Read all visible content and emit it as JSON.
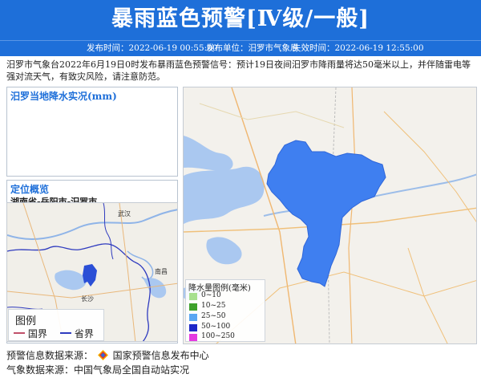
{
  "header": {
    "title": "暴雨蓝色预警[Ⅳ级/一般]",
    "publish_time": "发布时间：2022-06-19 00:55:00",
    "publisher": "发布单位：汨罗市气象局",
    "expire_time": "失效时间：2022-06-19 12:55:00"
  },
  "description": "汨罗市气象台2022年6月19日0时发布暴雨蓝色预警信号：预计19日夜间汨罗市降雨量将达50毫米以上，并伴随雷电等强对流天气，有致灾风险，请注意防范。",
  "rain_panel": {
    "title": "汨罗当地降水实况(mm)"
  },
  "location_panel": {
    "title": "定位概览",
    "subtitle": "湖南省-岳阳市-汨罗市"
  },
  "rain_legend": {
    "title": "降水量图例(毫米)",
    "items": [
      {
        "label": "0~10",
        "color": "#a7e08f"
      },
      {
        "label": "10~25",
        "color": "#3ea12c"
      },
      {
        "label": "25~50",
        "color": "#5aa6f2"
      },
      {
        "label": "50~100",
        "color": "#1d27c8"
      },
      {
        "label": "100~250",
        "color": "#e43ae0"
      }
    ]
  },
  "location_legend": {
    "title": "图例",
    "national_border": "国界",
    "provincial_border": "省界"
  },
  "location_map_labels": {
    "wuhan": "武汉",
    "nanchang": "南昌",
    "changsha": "长沙"
  },
  "footer": {
    "warning_source": "预警信息数据来源：",
    "warning_source_name": "国家预警信息发布中心",
    "weather_source": "气象数据来源：中国气象局全国自动站实况"
  },
  "colors": {
    "banner": "#1e6fd9",
    "warning_area": "#3f7ff0",
    "water": "#aac8f0"
  }
}
